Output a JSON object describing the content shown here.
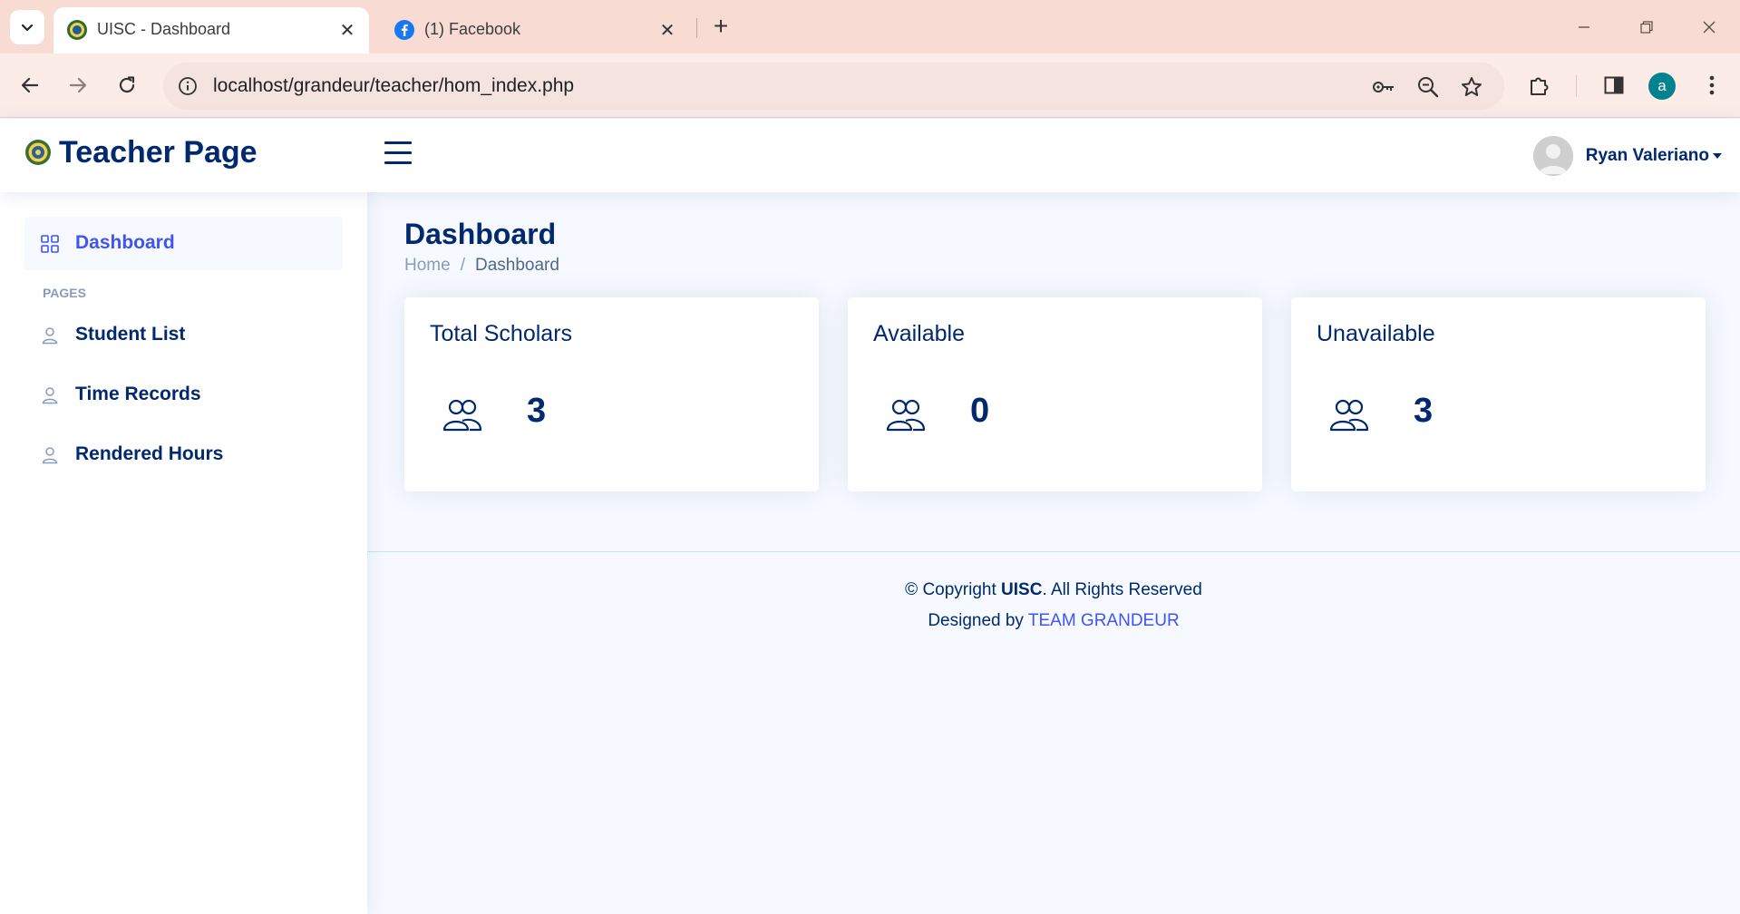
{
  "browser": {
    "tabs": [
      {
        "title": "UISC - Dashboard",
        "active": true
      },
      {
        "title": "(1) Facebook",
        "active": false
      }
    ],
    "url": "localhost/grandeur/teacher/hom_index.php",
    "profile_initial": "a"
  },
  "header": {
    "brand": "Teacher Page",
    "user_name": "Ryan Valeriano"
  },
  "sidebar": {
    "items": [
      {
        "label": "Dashboard",
        "icon": "grid-icon",
        "active": true
      },
      {
        "label": "Student List",
        "icon": "person-icon"
      },
      {
        "label": "Time Records",
        "icon": "person-icon"
      },
      {
        "label": "Rendered Hours",
        "icon": "person-icon"
      }
    ],
    "heading": "PAGES"
  },
  "main": {
    "title": "Dashboard",
    "breadcrumb": {
      "home": "Home",
      "separator": "/",
      "current": "Dashboard"
    },
    "cards": [
      {
        "title": "Total Scholars",
        "value": "3",
        "icon": "people-icon"
      },
      {
        "title": "Available",
        "value": "0",
        "icon": "people-icon"
      },
      {
        "title": "Unavailable",
        "value": "3",
        "icon": "people-icon"
      }
    ]
  },
  "footer": {
    "copyright_prefix": "© Copyright ",
    "copyright_brand": "UISC",
    "copyright_suffix": ". All Rights Reserved",
    "designed_prefix": "Designed by ",
    "designed_link": "TEAM GRANDEUR"
  },
  "colors": {
    "accent": "#4154f1",
    "navy": "#012970",
    "background": "#f6f9ff",
    "tabbar": "#f8dcd3"
  }
}
